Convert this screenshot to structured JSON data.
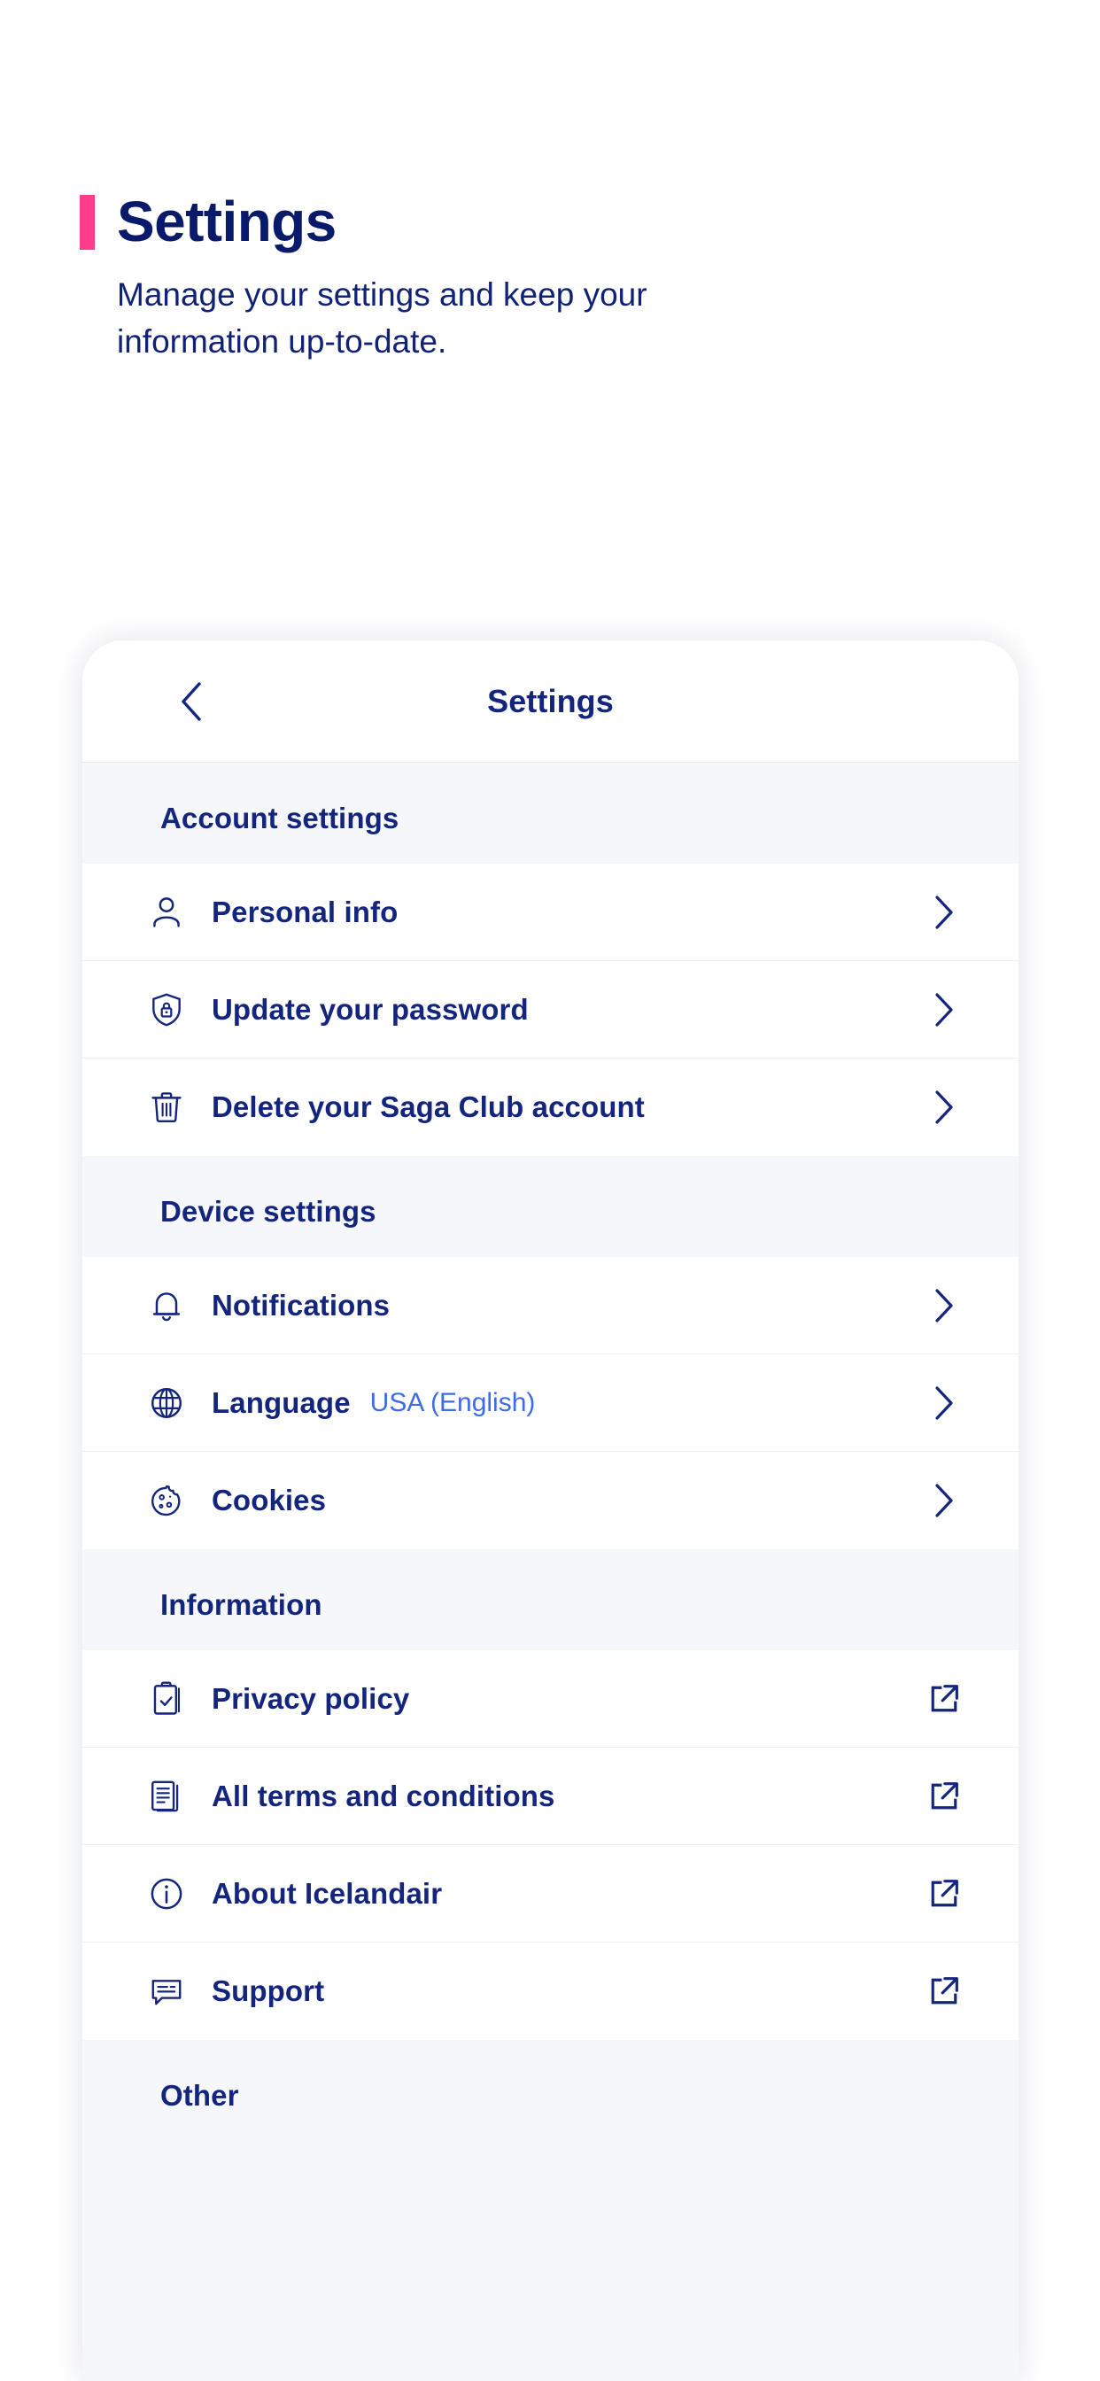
{
  "page": {
    "title": "Settings",
    "subtitle": "Manage your settings and keep your information up-to-date.",
    "accent_color": "#FF3D8B",
    "text_color": "#14257E",
    "link_color": "#3E6BE8"
  },
  "card": {
    "back_icon": "chevron-left-icon",
    "title": "Settings",
    "sections": [
      {
        "header": "Account settings",
        "rows": [
          {
            "icon": "person-icon",
            "label": "Personal info",
            "value": "",
            "action": "chevron-right-icon"
          },
          {
            "icon": "shield-lock-icon",
            "label": "Update your password",
            "value": "",
            "action": "chevron-right-icon"
          },
          {
            "icon": "trash-icon",
            "label": "Delete your Saga Club account",
            "value": "",
            "action": "chevron-right-icon"
          }
        ]
      },
      {
        "header": "Device settings",
        "rows": [
          {
            "icon": "bell-icon",
            "label": "Notifications",
            "value": "",
            "action": "chevron-right-icon"
          },
          {
            "icon": "globe-icon",
            "label": "Language",
            "value": "USA (English)",
            "action": "chevron-right-icon"
          },
          {
            "icon": "cookie-icon",
            "label": "Cookies",
            "value": "",
            "action": "chevron-right-icon"
          }
        ]
      },
      {
        "header": "Information",
        "rows": [
          {
            "icon": "clipboard-check-icon",
            "label": "Privacy policy",
            "value": "",
            "action": "external-link-icon"
          },
          {
            "icon": "documents-icon",
            "label": "All terms and conditions",
            "value": "",
            "action": "external-link-icon"
          },
          {
            "icon": "info-circle-icon",
            "label": "About Icelandair",
            "value": "",
            "action": "external-link-icon"
          },
          {
            "icon": "chat-icon",
            "label": "Support",
            "value": "",
            "action": "external-link-icon"
          }
        ]
      },
      {
        "header": "Other",
        "rows": []
      }
    ]
  }
}
